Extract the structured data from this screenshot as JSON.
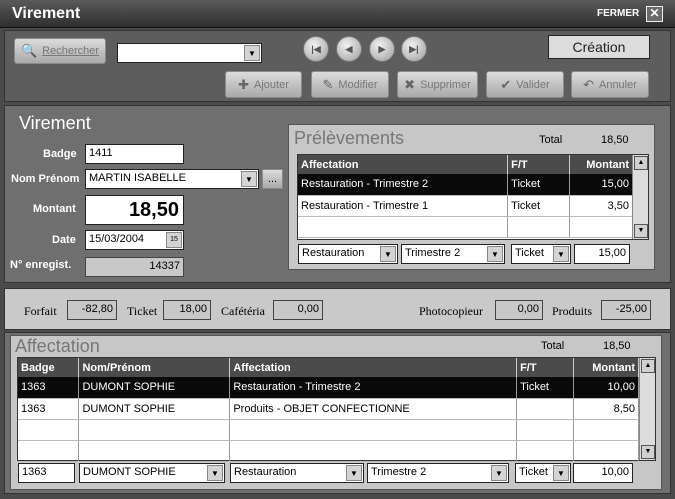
{
  "window": {
    "title": "Virement",
    "close_label": "FERMER",
    "close_glyph": "✕"
  },
  "toolbar": {
    "search_label": "Rechercher",
    "search_icon": "magnifier-icon",
    "search_value": "",
    "nav": [
      "|◀",
      "◀",
      "▶",
      "▶|"
    ],
    "mode": "Création",
    "add": "Ajouter",
    "edit": "Modifier",
    "delete": "Supprimer",
    "validate": "Valider",
    "cancel": "Annuler"
  },
  "form": {
    "heading": "Virement",
    "badge_label": "Badge",
    "badge": "1411",
    "name_label": "Nom Prénom",
    "name": "MARTIN ISABELLE",
    "name_btn": "...",
    "amount_label": "Montant",
    "amount": "18,50",
    "date_label": "Date",
    "date": "15/03/2004",
    "cal": "15",
    "reg_label": "N° enregist.",
    "reg": "14337"
  },
  "prelevements": {
    "title": "Prélèvements",
    "total_label": "Total",
    "total": "18,50",
    "columns": [
      "Affectation",
      "F/T",
      "Montant"
    ],
    "rows": [
      {
        "affectation": "Restauration - Trimestre 2",
        "ft": "Ticket",
        "montant": "15,00"
      },
      {
        "affectation": "Restauration - Trimestre 1",
        "ft": "Ticket",
        "montant": "3,50"
      }
    ],
    "edit": {
      "affectation": "Restauration",
      "trimestre": "Trimestre 2",
      "ft": "Ticket",
      "montant": "15,00"
    }
  },
  "soldes": {
    "forfait_label": "Forfait",
    "forfait": "-82,80",
    "ticket_label": "Ticket",
    "ticket": "18,00",
    "cafeteria_label": "Cafétéria",
    "cafeteria": "0,00",
    "photocopieur_label": "Photocopieur",
    "photocopieur": "0,00",
    "produits_label": "Produits",
    "produits": "-25,00"
  },
  "affectation": {
    "title": "Affectation",
    "total_label": "Total",
    "total": "18,50",
    "columns": [
      "Badge",
      "Nom/Prénom",
      "Affectation",
      "F/T",
      "Montant"
    ],
    "rows": [
      {
        "badge": "1363",
        "nom": "DUMONT SOPHIE",
        "affectation": "Restauration - Trimestre 2",
        "ft": "Ticket",
        "montant": "10,00"
      },
      {
        "badge": "1363",
        "nom": "DUMONT SOPHIE",
        "affectation": "Produits - OBJET CONFECTIONNE",
        "ft": "",
        "montant": "8,50"
      }
    ],
    "edit": {
      "badge": "1363",
      "nom": "DUMONT SOPHIE",
      "affectation": "Restauration",
      "trimestre": "Trimestre 2",
      "ft": "Ticket",
      "montant": "10,00"
    }
  }
}
